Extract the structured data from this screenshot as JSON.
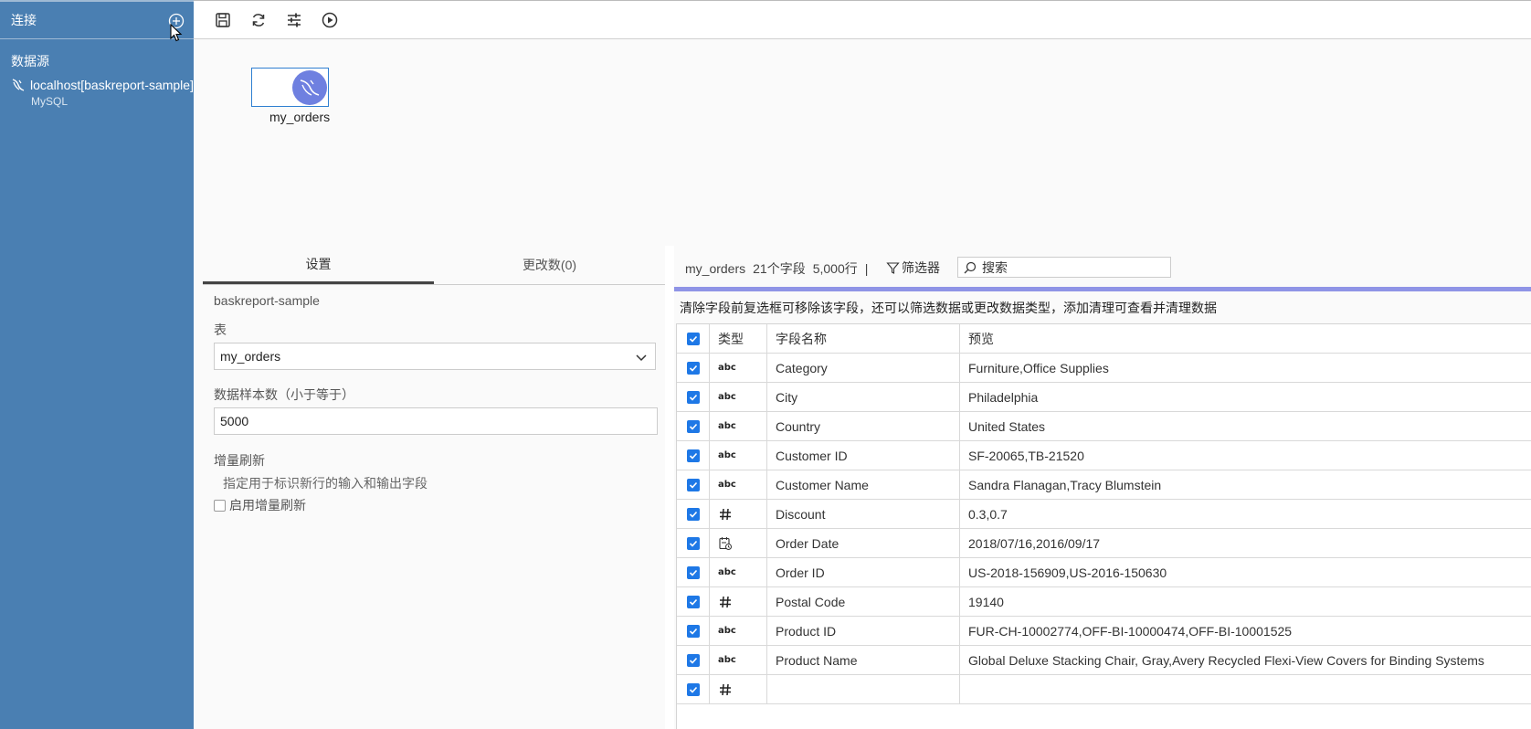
{
  "sidebar": {
    "title": "连接",
    "section_label": "数据源",
    "connection": {
      "name": "localhost[baskreport-sample]",
      "type": "MySQL"
    }
  },
  "canvas": {
    "table_node_label": "my_orders"
  },
  "settings": {
    "tabs": [
      {
        "label": "设置"
      },
      {
        "label": "更改数(0)"
      }
    ],
    "database_name": "baskreport-sample",
    "table_label": "表",
    "table_value": "my_orders",
    "sample_label": "数据样本数（小于等于）",
    "sample_value": "5000",
    "incremental_label": "增量刷新",
    "incremental_desc": "指定用于标识新行的输入和输出字段",
    "incremental_checkbox_label": "启用增量刷新"
  },
  "fields": {
    "table_name": "my_orders",
    "field_count": "21个字段",
    "row_count": "5,000行",
    "separator": "|",
    "filter_label": "筛选器",
    "search_placeholder": "搜索",
    "hint": "清除字段前复选框可移除该字段，还可以筛选数据或更改数据类型，添加清理可查看并清理数据",
    "headers": {
      "type": "类型",
      "name": "字段名称",
      "preview": "预览"
    },
    "rows": [
      {
        "type": "abc",
        "name": "Category",
        "preview": "Furniture,Office Supplies"
      },
      {
        "type": "abc",
        "name": "City",
        "preview": "Philadelphia"
      },
      {
        "type": "abc",
        "name": "Country",
        "preview": "United States"
      },
      {
        "type": "abc",
        "name": "Customer ID",
        "preview": "SF-20065,TB-21520"
      },
      {
        "type": "abc",
        "name": "Customer Name",
        "preview": "Sandra Flanagan,Tracy Blumstein"
      },
      {
        "type": "number",
        "name": "Discount",
        "preview": "0.3,0.7"
      },
      {
        "type": "date",
        "name": "Order Date",
        "preview": "2018/07/16,2016/09/17"
      },
      {
        "type": "abc",
        "name": "Order ID",
        "preview": "US-2018-156909,US-2016-150630"
      },
      {
        "type": "number",
        "name": "Postal Code",
        "preview": "19140"
      },
      {
        "type": "abc",
        "name": "Product ID",
        "preview": "FUR-CH-10002774,OFF-BI-10000474,OFF-BI-10001525"
      },
      {
        "type": "abc",
        "name": "Product Name",
        "preview": "Global Deluxe Stacking Chair, Gray,Avery Recycled Flexi-View Covers for Binding Systems"
      },
      {
        "type": "number",
        "name": "",
        "preview": ""
      }
    ]
  },
  "icons": {
    "add": "plus-circle-icon",
    "save": "save-icon",
    "refresh": "refresh-icon",
    "settings": "sliders-icon",
    "run": "play-circle-icon",
    "filter": "funnel-icon",
    "search": "search-icon"
  },
  "colors": {
    "sidebar_bg": "#4a7fb2",
    "checkbox": "#1e78e6",
    "node_border": "#2f7fd1",
    "mysql_icon": "#6f80e0",
    "hint_bar": "#8f94e6"
  }
}
